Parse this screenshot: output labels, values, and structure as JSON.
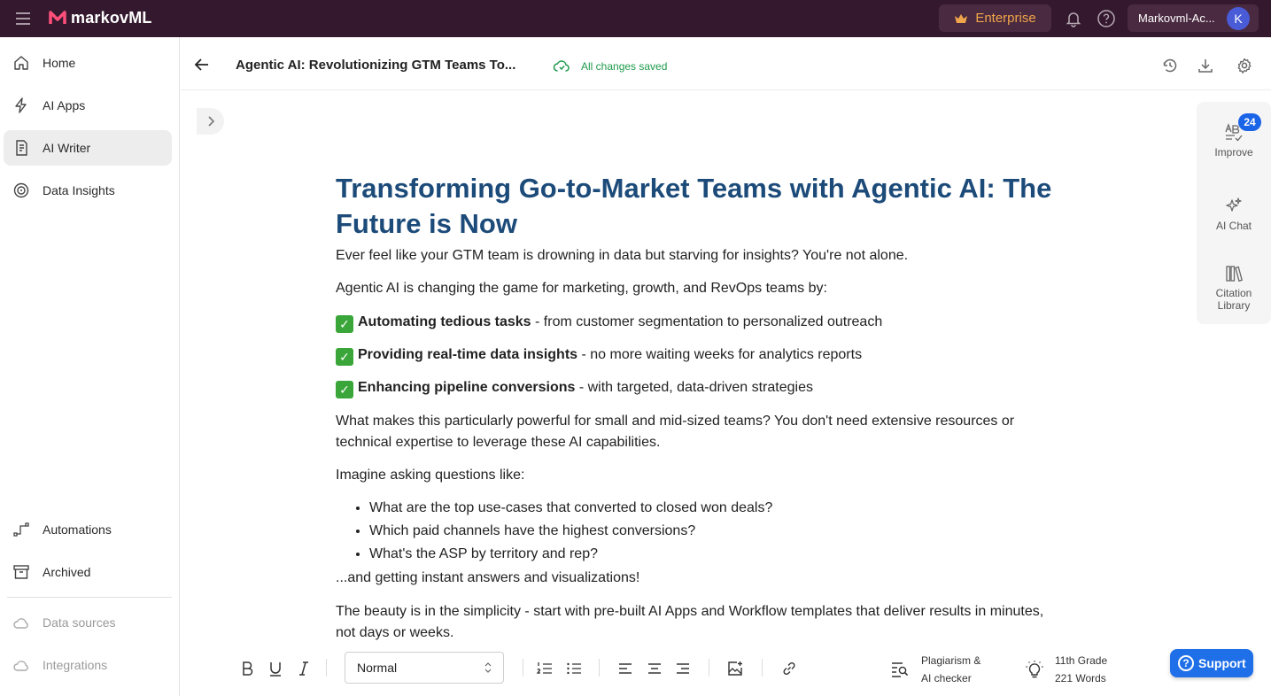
{
  "topbar": {
    "brand": "markovML",
    "enterprise_label": "Enterprise",
    "account_name": "Markovml-Ac...",
    "avatar_initial": "K"
  },
  "sidebar": {
    "items": [
      {
        "label": "Home",
        "icon": "home-icon"
      },
      {
        "label": "AI Apps",
        "icon": "bolt-icon"
      },
      {
        "label": "AI Writer",
        "icon": "document-icon"
      },
      {
        "label": "Data Insights",
        "icon": "insights-icon"
      },
      {
        "label": "Automations",
        "icon": "workflow-icon"
      },
      {
        "label": "Archived",
        "icon": "archive-icon"
      },
      {
        "label": "Data sources",
        "icon": "cloud-icon"
      },
      {
        "label": "Integrations",
        "icon": "cloud-icon"
      }
    ],
    "active_index": 2
  },
  "document": {
    "title": "Agentic AI: Revolutionizing GTM Teams To...",
    "save_status": "All changes saved"
  },
  "right_panel": {
    "improve_label": "Improve",
    "improve_badge": "24",
    "ai_chat_label": "AI Chat",
    "citation_label_1": "Citation",
    "citation_label_2": "Library"
  },
  "content": {
    "heading": "Transforming Go-to-Market Teams with Agentic AI: The Future is Now",
    "p1": "Ever feel like your GTM team is drowning in data but starving for insights? You're not alone.",
    "p2": "Agentic AI is changing the game for marketing, growth, and RevOps teams by:",
    "checks": [
      {
        "bold": "Automating tedious tasks",
        "rest": " - from customer segmentation to personalized outreach"
      },
      {
        "bold": "Providing real-time data insights",
        "rest": " - no more waiting weeks for analytics reports"
      },
      {
        "bold": "Enhancing pipeline conversions",
        "rest": " - with targeted, data-driven strategies"
      }
    ],
    "check_mark": "✓",
    "p3": "What makes this particularly powerful for small and mid-sized teams? You don't need extensive resources or technical expertise to leverage these AI capabilities.",
    "p4": "Imagine asking questions like:",
    "questions": [
      "What are the top use-cases that converted to closed won deals?",
      "Which paid channels have the highest conversions?",
      "What's the ASP by territory and rep?"
    ],
    "p5": "...and getting instant answers and visualizations!",
    "p6": "The beauty is in the simplicity - start with pre-built AI Apps and Workflow templates that deliver results in minutes, not days or weeks."
  },
  "toolbar": {
    "style_value": "Normal",
    "plagiarism_line1": "Plagiarism &",
    "plagiarism_line2": "AI checker",
    "grade": "11th Grade",
    "words": "221 Words"
  },
  "support_label": "Support",
  "support_icon_glyph": "?",
  "colors": {
    "topbar": "#34192e",
    "heading": "#1c4b7a",
    "accent_blue": "#1f6fe8",
    "saved_green": "#1e9a4c",
    "enterprise": "#f0a54a"
  }
}
